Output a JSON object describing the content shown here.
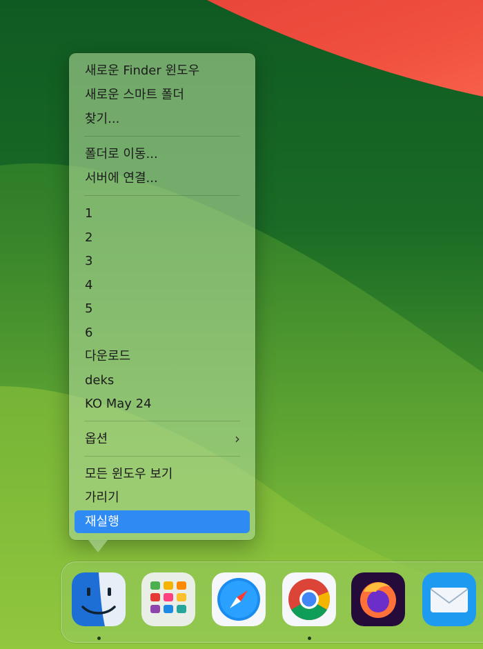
{
  "context_menu": {
    "items": [
      {
        "label": "새로운 Finder 윈도우"
      },
      {
        "label": "새로운 스마트 폴더"
      },
      {
        "label": "찾기..."
      },
      {
        "label": "폴더로 이동..."
      },
      {
        "label": "서버에 연결..."
      },
      {
        "label": "1"
      },
      {
        "label": "2"
      },
      {
        "label": "3"
      },
      {
        "label": "4"
      },
      {
        "label": "5"
      },
      {
        "label": "6"
      },
      {
        "label": "다운로드"
      },
      {
        "label": "deks"
      },
      {
        "label": "KO May 24"
      },
      {
        "label": "옵션",
        "has_submenu": true
      },
      {
        "label": "모든 윈도우 보기"
      },
      {
        "label": "가리기"
      },
      {
        "label": "재실행",
        "selected": true
      }
    ]
  },
  "dock": {
    "apps": [
      {
        "name": "finder-icon",
        "running": true
      },
      {
        "name": "launchpad-icon",
        "running": false
      },
      {
        "name": "safari-icon",
        "running": false
      },
      {
        "name": "chrome-icon",
        "running": true
      },
      {
        "name": "firefox-icon",
        "running": false
      },
      {
        "name": "mail-icon",
        "running": false
      }
    ]
  },
  "colors": {
    "selection": "#2f8bf3",
    "wallpaper_green": "#2d6a24",
    "wallpaper_red": "#f24a3d"
  }
}
